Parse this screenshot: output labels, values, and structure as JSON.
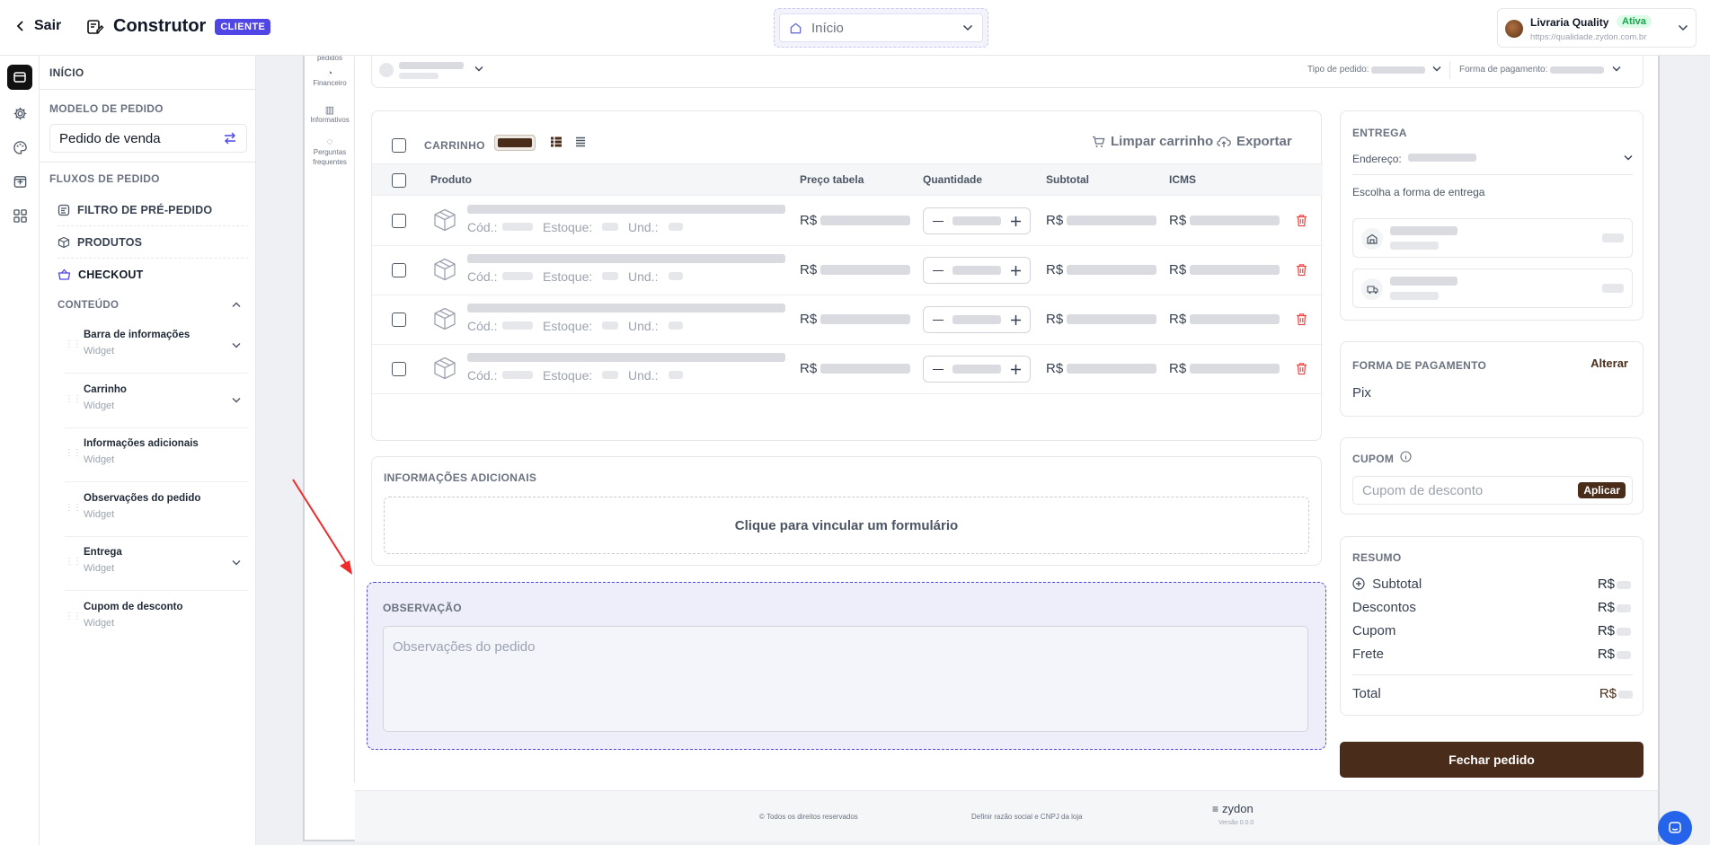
{
  "topbar": {
    "back_label": "Sair",
    "title": "Construtor",
    "badge": "CLIENTE",
    "page_select_value": "Início",
    "store_name": "Livraria Quality",
    "store_status": "Ativa",
    "store_url": "https://qualidade.zydon.com.br"
  },
  "sidebar": {
    "inicio": "INÍCIO",
    "modelo_header": "MODELO DE PEDIDO",
    "modelo_value": "Pedido de venda",
    "fluxos_header": "FLUXOS DE PEDIDO",
    "flows": [
      {
        "label": "FILTRO DE PRÉ-PEDIDO",
        "icon": "filter-list-icon"
      },
      {
        "label": "PRODUTOS",
        "icon": "box-icon"
      },
      {
        "label": "CHECKOUT",
        "icon": "basket-icon"
      }
    ],
    "conteudo_header": "CONTEÚDO",
    "widgets": [
      {
        "title": "Barra de informações",
        "subtitle": "Widget"
      },
      {
        "title": "Carrinho",
        "subtitle": "Widget"
      },
      {
        "title": "Informações adicionais",
        "subtitle": "Widget"
      },
      {
        "title": "Observações do pedido",
        "subtitle": "Widget"
      },
      {
        "title": "Entrega",
        "subtitle": "Widget"
      },
      {
        "title": "Cupom de desconto",
        "subtitle": "Widget"
      }
    ]
  },
  "preview_nav": {
    "top_cut": "pedidos",
    "items": [
      "Financeiro",
      "Informativos",
      "Perguntas frequentes"
    ]
  },
  "info_bar": {
    "tipo_label": "Tipo de pedido:",
    "pagamento_label": "Forma de pagamento:"
  },
  "cart": {
    "title": "CARRINHO",
    "clear_label": "Limpar carrinho",
    "export_label": "Exportar",
    "columns": [
      "Produto",
      "Preço tabela",
      "Quantidade",
      "Subtotal",
      "ICMS"
    ],
    "row_labels": {
      "cod": "Cód.:",
      "estoque": "Estoque:",
      "und": "Und.:",
      "currency": "R$"
    },
    "row_count": 4
  },
  "info_adicionais": {
    "title": "INFORMAÇÕES ADICIONAIS",
    "link_form": "Clique para vincular um formulário"
  },
  "observacao": {
    "title": "OBSERVAÇÃO",
    "placeholder": "Observações do pedido"
  },
  "entrega": {
    "title": "ENTREGA",
    "endereco_label": "Endereço:",
    "choose_label": "Escolha a forma de entrega"
  },
  "pagamento": {
    "title": "FORMA DE PAGAMENTO",
    "alter_label": "Alterar",
    "value": "Pix"
  },
  "cupom": {
    "title": "CUPOM",
    "placeholder": "Cupom de desconto",
    "apply_label": "Aplicar"
  },
  "resumo": {
    "title": "RESUMO",
    "rows": [
      "Subtotal",
      "Descontos",
      "Cupom",
      "Frete"
    ],
    "total_label": "Total",
    "currency": "R$"
  },
  "checkout_button": "Fechar pedido",
  "footer": {
    "rights": "© Todos os direitos reservados",
    "define": "Definir razão social e CNPJ da loja",
    "brand": "zydon",
    "version": "Versão 0.0.0"
  },
  "colors": {
    "accent": "#4f46e5",
    "brand_brown": "#4a2c1a",
    "danger": "#ef4444",
    "selection": "#eeeefb",
    "arrow": "#ef2b2b"
  }
}
